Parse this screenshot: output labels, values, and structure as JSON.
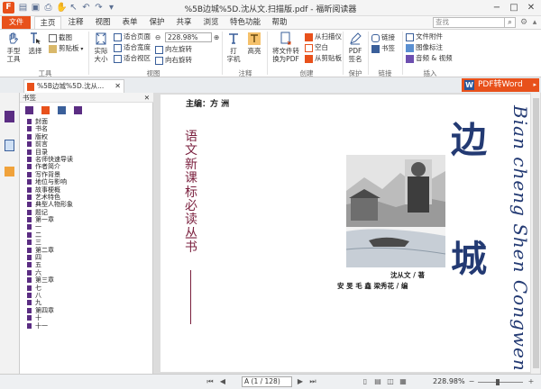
{
  "window": {
    "title": "%5B边城%5D.沈从文.扫描版.pdf - 福昕阅读器",
    "logo_text": "F"
  },
  "menu": {
    "file": "文件",
    "items": [
      "主页",
      "注释",
      "视图",
      "表单",
      "保护",
      "共享",
      "浏览",
      "特色功能",
      "帮助"
    ],
    "active_index": 0,
    "search_placeholder": "查找"
  },
  "ribbon": {
    "tools": {
      "hand": "手型\n工具",
      "select": "选择",
      "screenshot": "截图",
      "clipboard": "剪贴板",
      "group": "工具"
    },
    "view": {
      "actual": "实际\n大小",
      "fit_page": "适合页面",
      "fit_width": "适合宽度",
      "fit_view": "适合视区",
      "zoom": "228.98%",
      "rotate_left": "向左旋转",
      "rotate_right": "向右旋转",
      "group": "视图"
    },
    "comment": {
      "typewriter": "打\n字机",
      "highlight": "高亮",
      "group": "注释"
    },
    "create": {
      "convert": "将文件转\n换为PDF",
      "from_scanner": "从扫描仪",
      "blank": "空白",
      "from_clipboard": "从剪贴板",
      "group": "创建"
    },
    "protect": {
      "sign": "PDF\n签名",
      "group": "保护"
    },
    "links": {
      "link": "链接",
      "bookmark": "书签",
      "group": "链接"
    },
    "insert": {
      "attachment": "文件附件",
      "image": "图像标注",
      "audio": "音频 & 视频",
      "group": "插入"
    }
  },
  "tabs": {
    "doc_tab": "%5B边城%5D.沈从...",
    "pdf_to_word": "PDF转Word"
  },
  "bookmarks": {
    "header": "书签",
    "items": [
      "封面",
      "书名",
      "版权",
      "前言",
      "目录",
      "名师快速导读",
      "作者简介",
      "写作背景",
      "地位与影响",
      "故事梗概",
      "艺术特色",
      "典型人物形象",
      "题记",
      "第一章",
      "一",
      "二",
      "三",
      "第二章",
      "四",
      "五",
      "六",
      "第三章",
      "七",
      "八",
      "九",
      "第四章",
      "十",
      "十一"
    ]
  },
  "page": {
    "editor": "主编：方 洲",
    "series_title": "语文新课标必读丛书",
    "title_char1": "边",
    "title_char2": "城",
    "pinyin": "Bian cheng Shen Congwen",
    "author": "沈从文 / 著",
    "annotators": "安 旻  毛 鑫  梁秀花 / 编"
  },
  "status": {
    "page_display": "A (1 / 128)",
    "zoom": "228.98%"
  },
  "colors": {
    "accent": "#e8511b",
    "bookmark_flag": "#5b2d83",
    "title_blue": "#233a73",
    "series_red": "#7a1f3d"
  }
}
